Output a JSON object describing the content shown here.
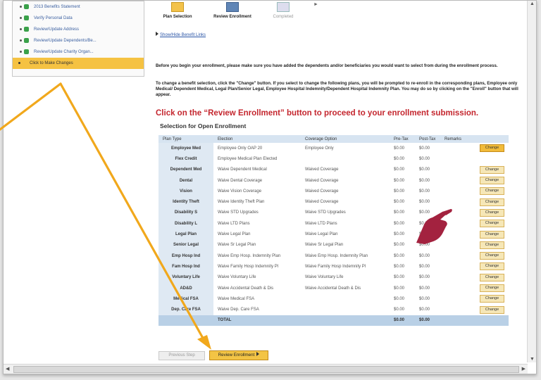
{
  "left_nav": {
    "items": [
      {
        "label": "2013 Benefits Statement",
        "checked": true
      },
      {
        "label": "Verify Personal Data",
        "checked": true
      },
      {
        "label": "Review/Update Address",
        "checked": true
      },
      {
        "label": "Review/Update Dependents/Be...",
        "checked": true
      },
      {
        "label": "Review/Update Charity Organ...",
        "checked": true
      },
      {
        "label": "Click to Make Changes",
        "checked": false,
        "active": true
      }
    ]
  },
  "steps": [
    {
      "label": "Plan Selection"
    },
    {
      "label": "Review Enrollment"
    },
    {
      "label": "Completed"
    }
  ],
  "show_hide_link": "Show/Hide Benefit Links",
  "instructions": {
    "para1": "Before you begin your enrollment, please make sure you have added the dependents and/or beneficiaries you would want to select from during the enrollment process.",
    "para2": "To change a benefit selection, click the \"Change\" button.  If you select to change the following plans, you will be prompted to re-enroll in the corresponding plans, Employee only Medical/ Dependent Medical, Legal Plan/Senior Legal, Employee Hospital Indemnity/Dependent Hospital Indemnity Plan.  You may do so by clicking on the \"Enroll\" button that will appear."
  },
  "headline": "Click on the “Review Enrollment” button to proceed to your enrollment submission.",
  "section_title": "Selection for Open Enrollment",
  "table": {
    "headers": [
      "Plan Type",
      "Election",
      "Coverage Option",
      "Pre-Tax",
      "Post-Tax",
      "Remarks",
      ""
    ],
    "rows": [
      {
        "plan": "Employee Med",
        "election": "Employee Only OAP 20",
        "coverage": "Employee Only",
        "pre": "$0.00",
        "post": "$0.00",
        "remarks": "",
        "action": "Change",
        "highlight": true
      },
      {
        "plan": "Flex Credit",
        "election": "Employee Medical Plan Elected",
        "coverage": "",
        "pre": "$0.00",
        "post": "$0.00",
        "remarks": "",
        "action": ""
      },
      {
        "plan": "Dependent Med",
        "election": "Waive Dependent  Medical",
        "coverage": "Waived Coverage",
        "pre": "$0.00",
        "post": "$0.00",
        "remarks": "",
        "action": "Change"
      },
      {
        "plan": "Dental",
        "election": "Waive Dental Coverage",
        "coverage": "Waived Coverage",
        "pre": "$0.00",
        "post": "$0.00",
        "remarks": "",
        "action": "Change"
      },
      {
        "plan": "Vision",
        "election": "Waive Vision Coverage",
        "coverage": "Waived Coverage",
        "pre": "$0.00",
        "post": "$0.00",
        "remarks": "",
        "action": "Change"
      },
      {
        "plan": "Identity Theft",
        "election": "Waive Identity Theft Plan",
        "coverage": "Waived Coverage",
        "pre": "$0.00",
        "post": "$0.00",
        "remarks": "",
        "action": "Change"
      },
      {
        "plan": "Disability S",
        "election": "Waive STD Upgrades",
        "coverage": "Waive STD Upgrades",
        "pre": "$0.00",
        "post": "$0.00",
        "remarks": "",
        "action": "Change"
      },
      {
        "plan": "Disability L",
        "election": "Waive LTD Plans",
        "coverage": "Waive LTD Plans",
        "pre": "$0.00",
        "post": "$0.00",
        "remarks": "",
        "action": "Change"
      },
      {
        "plan": "Legal Plan",
        "election": "Waive Legal Plan",
        "coverage": "Waive Legal Plan",
        "pre": "$0.00",
        "post": "$0.00",
        "remarks": "",
        "action": "Change"
      },
      {
        "plan": "Senior Legal",
        "election": "Waive Sr Legal Plan",
        "coverage": "Waive Sr Legal Plan",
        "pre": "$0.00",
        "post": "$0.00",
        "remarks": "",
        "action": "Change"
      },
      {
        "plan": "Emp Hosp Ind",
        "election": "Waive Emp Hosp. Indemnity Plan",
        "coverage": "Waive Emp Hosp. Indemnity Plan",
        "pre": "$0.00",
        "post": "$0.00",
        "remarks": "",
        "action": "Change"
      },
      {
        "plan": "Fam Hosp Ind",
        "election": "Waive Family Hosp Indemnity Pl",
        "coverage": "Waive Family Hosp Indemnity Pl",
        "pre": "$0.00",
        "post": "$0.00",
        "remarks": "",
        "action": "Change"
      },
      {
        "plan": "Voluntary Life",
        "election": "Waive Voluntary Life",
        "coverage": "Waive Voluntary Life",
        "pre": "$0.00",
        "post": "$0.00",
        "remarks": "",
        "action": "Change"
      },
      {
        "plan": "AD&D",
        "election": "Waive Accidental Death & Dis",
        "coverage": "Waive Accidental Death & Dis",
        "pre": "$0.00",
        "post": "$0.00",
        "remarks": "",
        "action": "Change"
      },
      {
        "plan": "Medical FSA",
        "election": "Waive Medical FSA",
        "coverage": "",
        "pre": "$0.00",
        "post": "$0.00",
        "remarks": "",
        "action": "Change"
      },
      {
        "plan": "Dep. Care FSA",
        "election": "Waive Dep. Care FSA",
        "coverage": "",
        "pre": "$0.00",
        "post": "$0.00",
        "remarks": "",
        "action": "Change"
      }
    ],
    "total": {
      "label": "TOTAL",
      "pre": "$0.00",
      "post": "$0.00"
    }
  },
  "buttons": {
    "previous": "Previous Step",
    "review": "Review Enrollment"
  },
  "colors": {
    "accent_orange": "#f1a81c",
    "headline_red": "#c4262e",
    "pointer_maroon": "#a3223f",
    "header_blue": "#d7e4f1"
  }
}
